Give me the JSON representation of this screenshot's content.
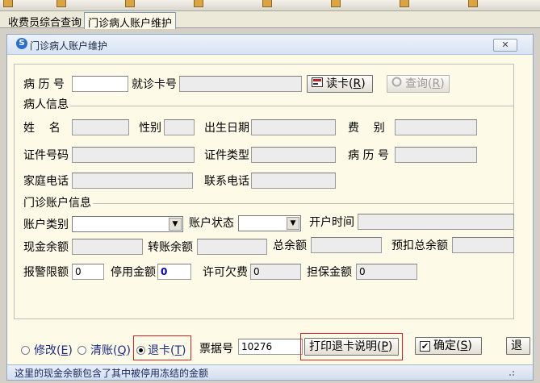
{
  "tabs": [
    "收费员综合查询",
    "门诊病人账户维护"
  ],
  "window": {
    "title": "门诊病人账户维护",
    "close_icon": "close-icon"
  },
  "search": {
    "record_no_label": "病 历 号",
    "record_no_value": "",
    "card_no_label": "就诊卡号",
    "card_no_value": "",
    "read_card_label": "读卡(",
    "read_card_key": "R",
    "read_card_suffix": ")",
    "query_label": "查询(",
    "query_key": "R",
    "query_suffix": ")"
  },
  "patient": {
    "group_title": "病人信息",
    "name_label": "姓    名",
    "sex_label": "性别",
    "dob_label": "出生日期",
    "fee_type_label": "费    别",
    "id_no_label": "证件号码",
    "id_type_label": "证件类型",
    "record_no_label": "病 历 号",
    "home_phone_label": "家庭电话",
    "contact_phone_label": "联系电话"
  },
  "account": {
    "group_title": "门诊账户信息",
    "account_type_label": "账户类别",
    "account_status_label": "账户状态",
    "open_time_label": "开户时间",
    "cash_balance_label": "现金余额",
    "transfer_balance_label": "转账余额",
    "total_balance_label": "总余额",
    "prepaid_total_label": "预扣总余额",
    "alarm_limit_label": "报警限额",
    "alarm_limit_value": "0",
    "stop_amount_label": "停用金额",
    "stop_amount_value": "0",
    "allowed_debt_label": "许可欠费",
    "allowed_debt_value": "0",
    "guarantee_label": "担保金额",
    "guarantee_value": "0"
  },
  "actions": {
    "modify_label": "修改(",
    "modify_key": "E",
    "settle_label": "清账(",
    "settle_key": "Q",
    "refund_label": "退卡(",
    "refund_key": "T",
    "close_paren": ")",
    "receipt_label": "票据号",
    "receipt_value": "10276",
    "print_label": "打印退卡说明(",
    "print_key": "P",
    "confirm_label": "确定(",
    "confirm_key": "S",
    "extra_btn_label": "退"
  },
  "status": {
    "message": "这里的现金余额包含了其中被停用冻结的金额"
  },
  "colors": {
    "accent_red": "#e02020",
    "panel_bg": "#fdfbe8",
    "title_bar": "#d7e3f3"
  }
}
